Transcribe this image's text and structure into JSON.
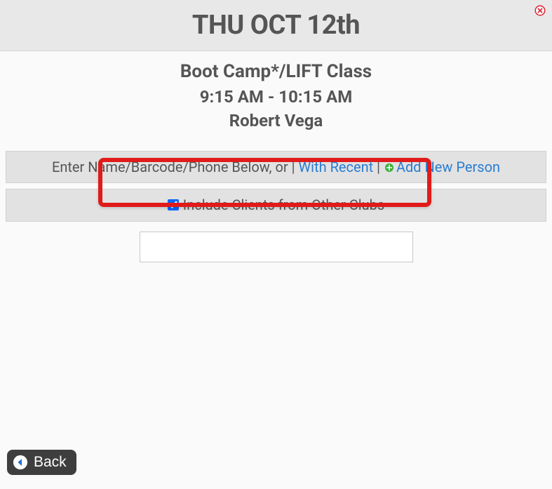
{
  "header": {
    "date_title": "THU OCT 12th"
  },
  "class": {
    "name": "Boot Camp*/LIFT Class",
    "time": "9:15 AM - 10:15 AM",
    "instructor": "Robert Vega"
  },
  "search_row": {
    "prompt": "Enter Name/Barcode/Phone Below, or",
    "with_recent": "With Recent",
    "add_new_person": "Add New Person"
  },
  "include_row": {
    "label": "Include Clients from Other Clubs",
    "checked": true
  },
  "search_input": {
    "value": "",
    "placeholder": ""
  },
  "back_button": {
    "label": "Back"
  }
}
